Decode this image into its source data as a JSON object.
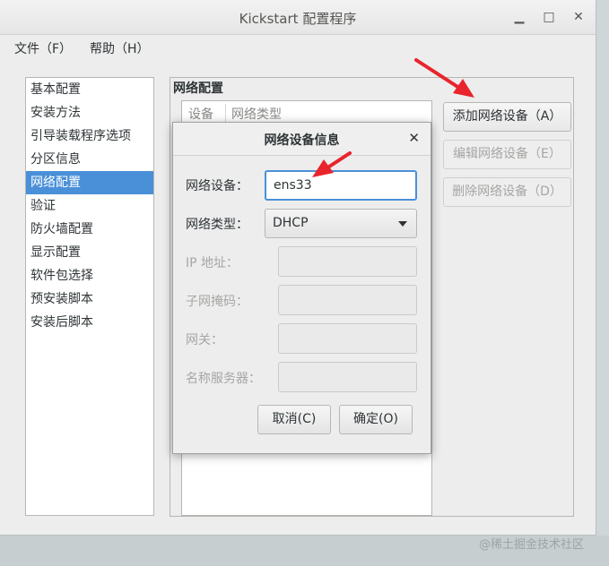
{
  "window": {
    "title": "Kickstart 配置程序"
  },
  "menu": [
    "文件（F）",
    "帮助（H）"
  ],
  "sidebar": {
    "items": [
      "基本配置",
      "安装方法",
      "引导装载程序选项",
      "分区信息",
      "网络配置",
      "验证",
      "防火墙配置",
      "显示配置",
      "软件包选择",
      "预安装脚本",
      "安装后脚本"
    ],
    "selected": "网络配置"
  },
  "panel": {
    "title": "网络配置",
    "columns": [
      "设备",
      "网络类型"
    ]
  },
  "buttons": {
    "add": "添加网络设备（A）",
    "edit": "编辑网络设备（E）",
    "delete": "删除网络设备（D）"
  },
  "dialog": {
    "title": "网络设备信息",
    "device_label": "网络设备：",
    "device_value": "ens33",
    "type_label": "网络类型：",
    "type_value": "DHCP",
    "ip_label": "IP 地址：",
    "netmask_label": "子网掩码：",
    "gateway_label": "网关：",
    "nameserver_label": "名称服务器：",
    "cancel": "取消(C)",
    "ok": "确定(O)"
  },
  "watermark": "@稀土掘金技术社区",
  "colors": {
    "selection": "#4a90d9",
    "annotation_arrow": "#e8242c"
  }
}
